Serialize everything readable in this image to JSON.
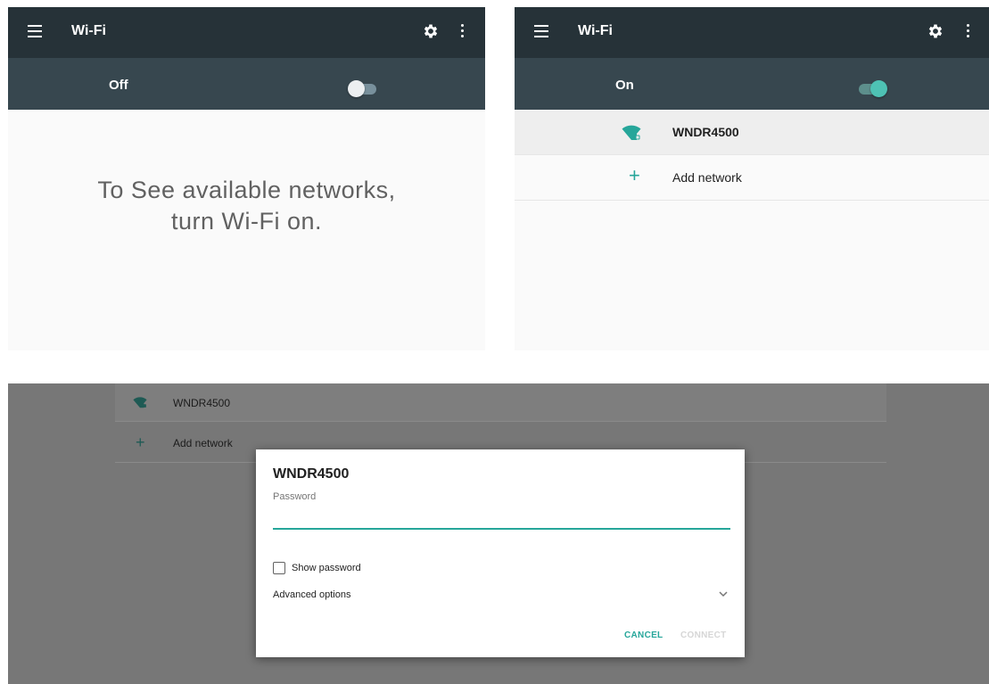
{
  "colors": {
    "appbar": "#263238",
    "switchbar": "#37474f",
    "accent": "#26a69a",
    "scrim": "#777777"
  },
  "panel_off": {
    "title": "Wi-Fi",
    "menu_icon": "hamburger-icon",
    "settings_icon": "gear-icon",
    "overflow_icon": "more-vert-icon",
    "state_label": "Off",
    "message_line1": "To See available networks,",
    "message_line2": "turn Wi-Fi on."
  },
  "panel_on": {
    "title": "Wi-Fi",
    "state_label": "On",
    "networks": [
      {
        "name": "WNDR4500",
        "icon": "wifi-lock-icon"
      },
      {
        "name": "Add network",
        "icon": "plus-icon"
      }
    ]
  },
  "dialog_background": {
    "networks": [
      {
        "name": "WNDR4500"
      },
      {
        "name": "Add network"
      }
    ]
  },
  "dialog": {
    "title": "WNDR4500",
    "password_label": "Password",
    "password_value": "",
    "show_password_label": "Show password",
    "show_password_checked": false,
    "advanced_label": "Advanced options",
    "cancel_label": "CANCEL",
    "connect_label": "CONNECT"
  }
}
